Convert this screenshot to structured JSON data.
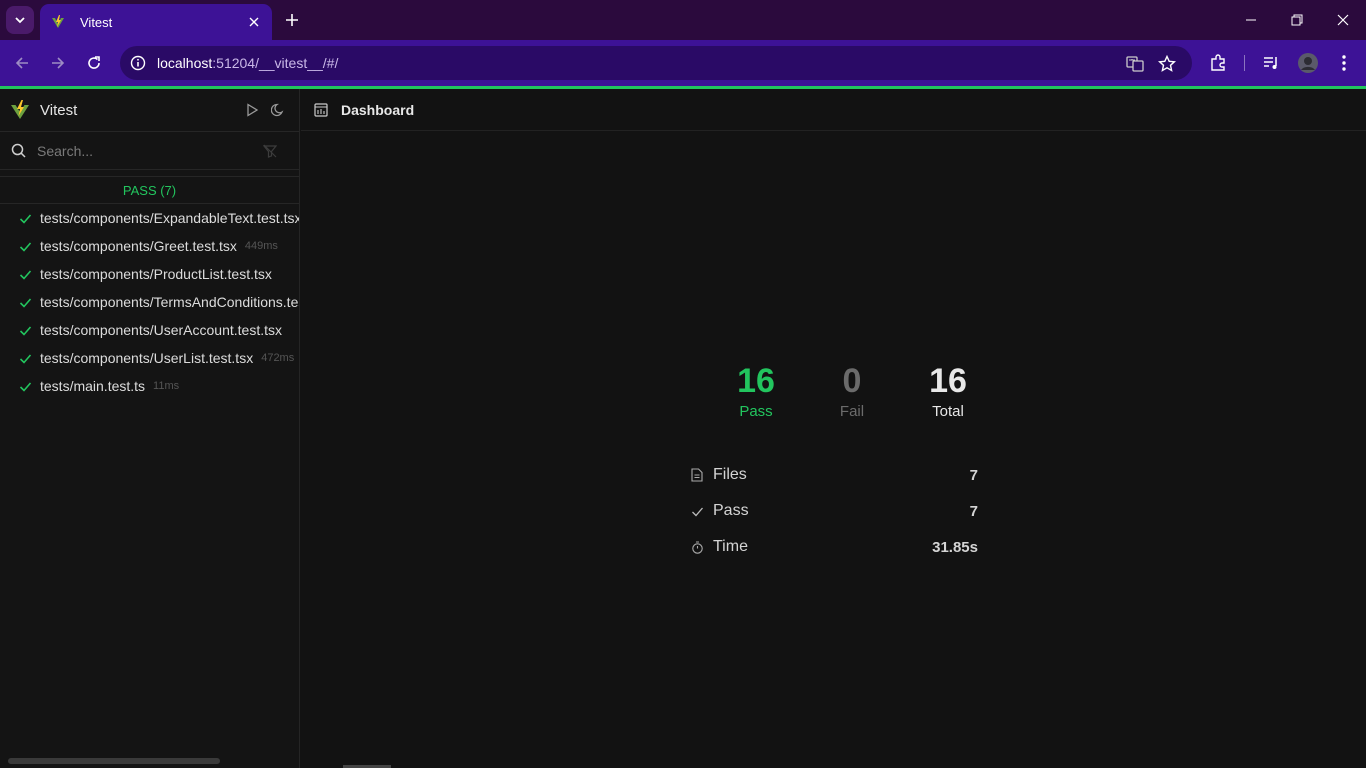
{
  "browser": {
    "tab_title": "Vitest",
    "url_host": "localhost",
    "url_rest": ":51204/__vitest__/#/"
  },
  "sidebar": {
    "app_name": "Vitest",
    "search_placeholder": "Search...",
    "pass_header": "PASS (7)",
    "files": [
      {
        "name": "tests/components/ExpandableText.test.tsx",
        "duration": ""
      },
      {
        "name": "tests/components/Greet.test.tsx",
        "duration": "449ms"
      },
      {
        "name": "tests/components/ProductList.test.tsx",
        "duration": ""
      },
      {
        "name": "tests/components/TermsAndConditions.test.tsx",
        "duration": ""
      },
      {
        "name": "tests/components/UserAccount.test.tsx",
        "duration": ""
      },
      {
        "name": "tests/components/UserList.test.tsx",
        "duration": "472ms"
      },
      {
        "name": "tests/main.test.ts",
        "duration": "11ms"
      }
    ]
  },
  "main": {
    "title": "Dashboard",
    "stats": {
      "pass_value": "16",
      "pass_label": "Pass",
      "fail_value": "0",
      "fail_label": "Fail",
      "total_value": "16",
      "total_label": "Total"
    },
    "details": [
      {
        "label": "Files",
        "value": "7"
      },
      {
        "label": "Pass",
        "value": "7"
      },
      {
        "label": "Time",
        "value": "31.85s"
      }
    ]
  },
  "colors": {
    "pass": "#22c55e",
    "tabstrip": "#2b0a3d",
    "toolbar": "#3d1296"
  }
}
